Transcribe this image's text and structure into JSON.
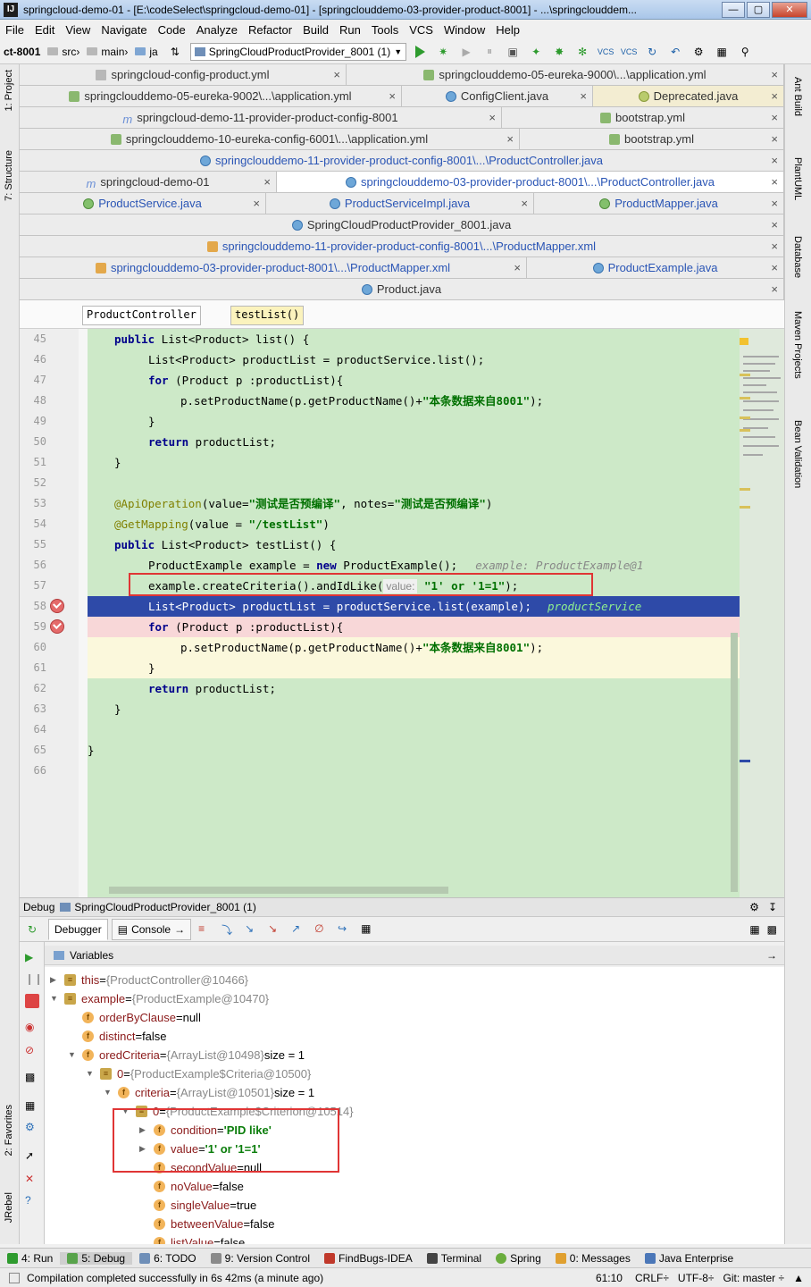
{
  "window": {
    "title": "springcloud-demo-01 - [E:\\codeSelect\\springcloud-demo-01] - [springclouddemo-03-provider-product-8001] - ...\\springclouddem...",
    "logo": "IJ"
  },
  "menu": [
    "File",
    "Edit",
    "View",
    "Navigate",
    "Code",
    "Analyze",
    "Refactor",
    "Build",
    "Run",
    "Tools",
    "VCS",
    "Window",
    "Help"
  ],
  "nav": {
    "module": "ct-8001",
    "src": "src",
    "main": "main",
    "ja": "ja",
    "run_config": "SpringCloudProductProvider_8001 (1)"
  },
  "tabs": {
    "r1": [
      "springcloud-config-product.yml",
      "springclouddemo-05-eureka-9000\\...\\application.yml"
    ],
    "r2": [
      "springclouddemo-05-eureka-9002\\...\\application.yml",
      "ConfigClient.java",
      "Deprecated.java"
    ],
    "r3": [
      "springcloud-demo-11-provider-product-config-8001",
      "bootstrap.yml"
    ],
    "r4": [
      "springclouddemo-10-eureka-config-6001\\...\\application.yml",
      "bootstrap.yml"
    ],
    "r5": [
      "springclouddemo-11-provider-product-config-8001\\...\\ProductController.java"
    ],
    "r6": [
      "springcloud-demo-01",
      "springclouddemo-03-provider-product-8001\\...\\ProductController.java"
    ],
    "r7": [
      "ProductService.java",
      "ProductServiceImpl.java",
      "ProductMapper.java"
    ],
    "r8": [
      "SpringCloudProductProvider_8001.java"
    ],
    "r9": [
      "springclouddemo-11-provider-product-config-8001\\...\\ProductMapper.xml"
    ],
    "r10": [
      "springclouddemo-03-provider-product-8001\\...\\ProductMapper.xml",
      "ProductExample.java"
    ],
    "r11": [
      "Product.java"
    ]
  },
  "breadcrumb": [
    "ProductController",
    "testList()"
  ],
  "code": {
    "n45": "45",
    "n46": "46",
    "n47": "47",
    "n48": "48",
    "n49": "49",
    "n50": "50",
    "n51": "51",
    "n52": "52",
    "n53": "53",
    "n54": "54",
    "n55": "55",
    "n56": "56",
    "n57": "57",
    "n58": "58",
    "n59": "59",
    "n60": "60",
    "n61": "61",
    "n62": "62",
    "n63": "63",
    "n64": "64",
    "n65": "65",
    "n66": "66",
    "l45_kw": "public",
    "l45_rest": " List<Product> list() {",
    "l46": "List<Product> productList = productService.list();",
    "l47_kw": "for",
    "l47_rest": " (Product p :productList){",
    "l48_a": "p.setProductName(p.getProductName()+",
    "l48_s": "\"本条数据来自8001\"",
    "l48_b": ");",
    "l49": "}",
    "l50_kw": "return",
    "l50_rest": " productList;",
    "l51": "}",
    "l53_ann": "@ApiOperation",
    "l53_a": "(value=",
    "l53_s1": "\"测试是否预编译\"",
    "l53_b": ", notes=",
    "l53_s2": "\"测试是否预编译\"",
    "l53_c": ")",
    "l54_ann": "@GetMapping",
    "l54_a": "(value = ",
    "l54_s": "\"/testList\"",
    "l54_b": ")",
    "l55_kw": "public",
    "l55_rest": " List<Product> testList() {",
    "l56_a": "ProductExample example = ",
    "l56_kw": "new",
    "l56_b": " ProductExample();",
    "l56_hint": "example: ProductExample@1",
    "l57_a": "example.createCriteria().andIdLike(",
    "l57_hint": "value:",
    "l57_s": "\"1' or '1=1\"",
    "l57_b": ");",
    "l58": "List<Product> productList = productService.list(example);",
    "l58_hint": "productService",
    "l59_kw": "for",
    "l59_rest": " (Product p :productList){",
    "l60_a": "p.setProductName(p.getProductName()+",
    "l60_s": "\"本条数据来自8001\"",
    "l60_b": ");",
    "l61": "}",
    "l62_kw": "return",
    "l62_rest": " productList;",
    "l63": "}",
    "l65": "}"
  },
  "debug": {
    "title": "Debug",
    "config": "SpringCloudProductProvider_8001 (1)",
    "tab_debugger": "Debugger",
    "tab_console": "Console",
    "variables_label": "Variables",
    "vars": [
      {
        "name": "this",
        "eq": " = ",
        "val": "{ProductController@10466}"
      },
      {
        "name": "example",
        "eq": " = ",
        "val": "{ProductExample@10470}"
      },
      {
        "name": "orderByClause",
        "eq": " = ",
        "val": "null"
      },
      {
        "name": "distinct",
        "eq": " = ",
        "val": "false"
      },
      {
        "name": "oredCriteria",
        "eq": " = ",
        "val": "{ArrayList@10498}",
        "extra": "  size = 1"
      },
      {
        "name": "0",
        "eq": " = ",
        "val": "{ProductExample$Criteria@10500}"
      },
      {
        "name": "criteria",
        "eq": " = ",
        "val": "{ArrayList@10501}",
        "extra": "  size = 1"
      },
      {
        "name": "0",
        "eq": " = ",
        "val": "{ProductExample$Criterion@10514}"
      },
      {
        "name": "condition",
        "eq": " = ",
        "val": "'PID like'"
      },
      {
        "name": "value",
        "eq": " = ",
        "val": "'1' or '1=1'"
      },
      {
        "name": "secondValue",
        "eq": " = ",
        "val": "null"
      },
      {
        "name": "noValue",
        "eq": " = ",
        "val": "false"
      },
      {
        "name": "singleValue",
        "eq": " = ",
        "val": "true"
      },
      {
        "name": "betweenValue",
        "eq": " = ",
        "val": "false"
      },
      {
        "name": "listValue",
        "eq": " = ",
        "val": "false"
      }
    ]
  },
  "left_tools": [
    "1: Project",
    "7: Structure",
    "2: Favorites",
    "JRebel"
  ],
  "right_tools": [
    "Ant Build",
    "PlantUML",
    "Database",
    "Maven Projects",
    "Bean Validation"
  ],
  "bottom_tools": [
    "4: Run",
    "5: Debug",
    "6: TODO",
    "9: Version Control",
    "FindBugs-IDEA",
    "Terminal",
    "Spring",
    "0: Messages",
    "Java Enterprise"
  ],
  "status": {
    "message": "Compilation completed successfully in 6s 42ms (a minute ago)",
    "position": "61:10",
    "line_sep": "CRLF÷",
    "encoding": "UTF-8÷",
    "git": "Git: master ÷"
  }
}
